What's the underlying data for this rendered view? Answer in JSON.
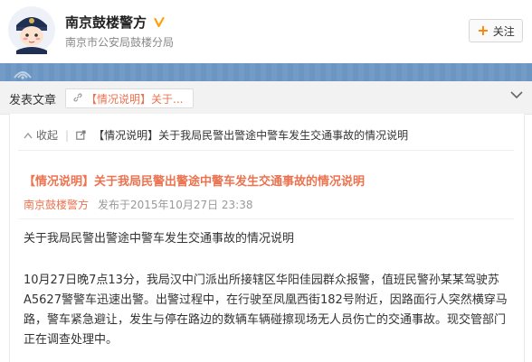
{
  "account": {
    "name": "南京鼓楼警方",
    "subtitle": "南京市公安局鼓楼分局",
    "follow_label": "关注"
  },
  "tabs": {
    "section_title": "发表文章",
    "active_tab_label": "【情况说明】关于..."
  },
  "breadcrumb": {
    "collapse_label": "收起",
    "article_link": "【情况说明】关于我局民警出警途中警车发生交通事故的情况说明"
  },
  "article": {
    "title": "【情况说明】关于我局民警出警途中警车发生交通事故的情况说明",
    "author": "南京鼓楼警方",
    "published": "发布于2015年10月27日 23:38",
    "p1": "关于我局民警出警途中警车发生交通事故的情况说明",
    "p2": "10月27日晚7点13分，我局汉中门派出所接辖区华阳佳园群众报警，值班民警孙某某驾驶苏A5627警警车迅速出警。出警过程中，在行驶至凤凰西街182号附近，因路面行人突然横穿马路，警车紧急避让，发生与停在路边的数辆车辆碰擦现场无人员伤亡的交通事故。现交管部门正在调查处理中。"
  },
  "colors": {
    "accent": "#eb7350",
    "banner": "#6b95c2",
    "verify": "#ffa00a",
    "follow_plus": "#ff8200"
  },
  "icons": {
    "verify": "verified-v-icon",
    "follow": "plus-icon",
    "collapse": "chevron-up-icon",
    "link": "external-link-icon",
    "expand": "chevron-down-icon"
  }
}
